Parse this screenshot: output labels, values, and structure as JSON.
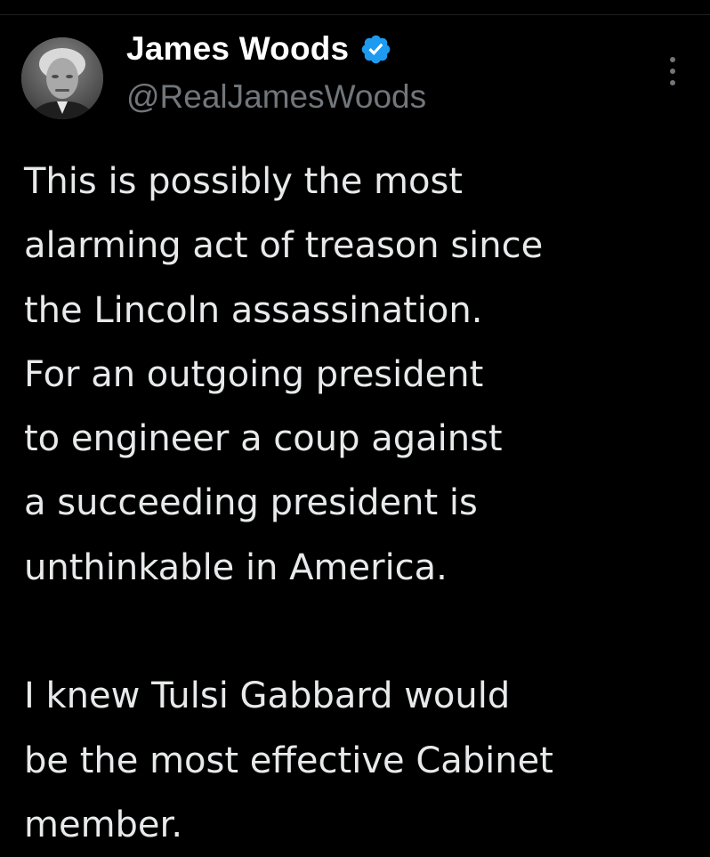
{
  "author": {
    "display_name": "James Woods",
    "handle": "@RealJamesWoods",
    "verified": true,
    "verified_color": "#1d9bf0",
    "avatar_icon": "profile-photo"
  },
  "actions": {
    "more_icon": "more-vertical-icon"
  },
  "tweet": {
    "paragraph1": [
      "This is possibly the most",
      "alarming act of treason since",
      "the Lincoln assassination.",
      "For an outgoing president",
      "to engineer a coup against",
      "a succeeding president is",
      "unthinkable in America."
    ],
    "paragraph2": [
      "I knew Tulsi Gabbard would",
      "be the most effective Cabinet",
      "member."
    ]
  },
  "theme": {
    "background": "#000000",
    "text": "#e7e9ea",
    "secondary_text": "#71767b"
  }
}
